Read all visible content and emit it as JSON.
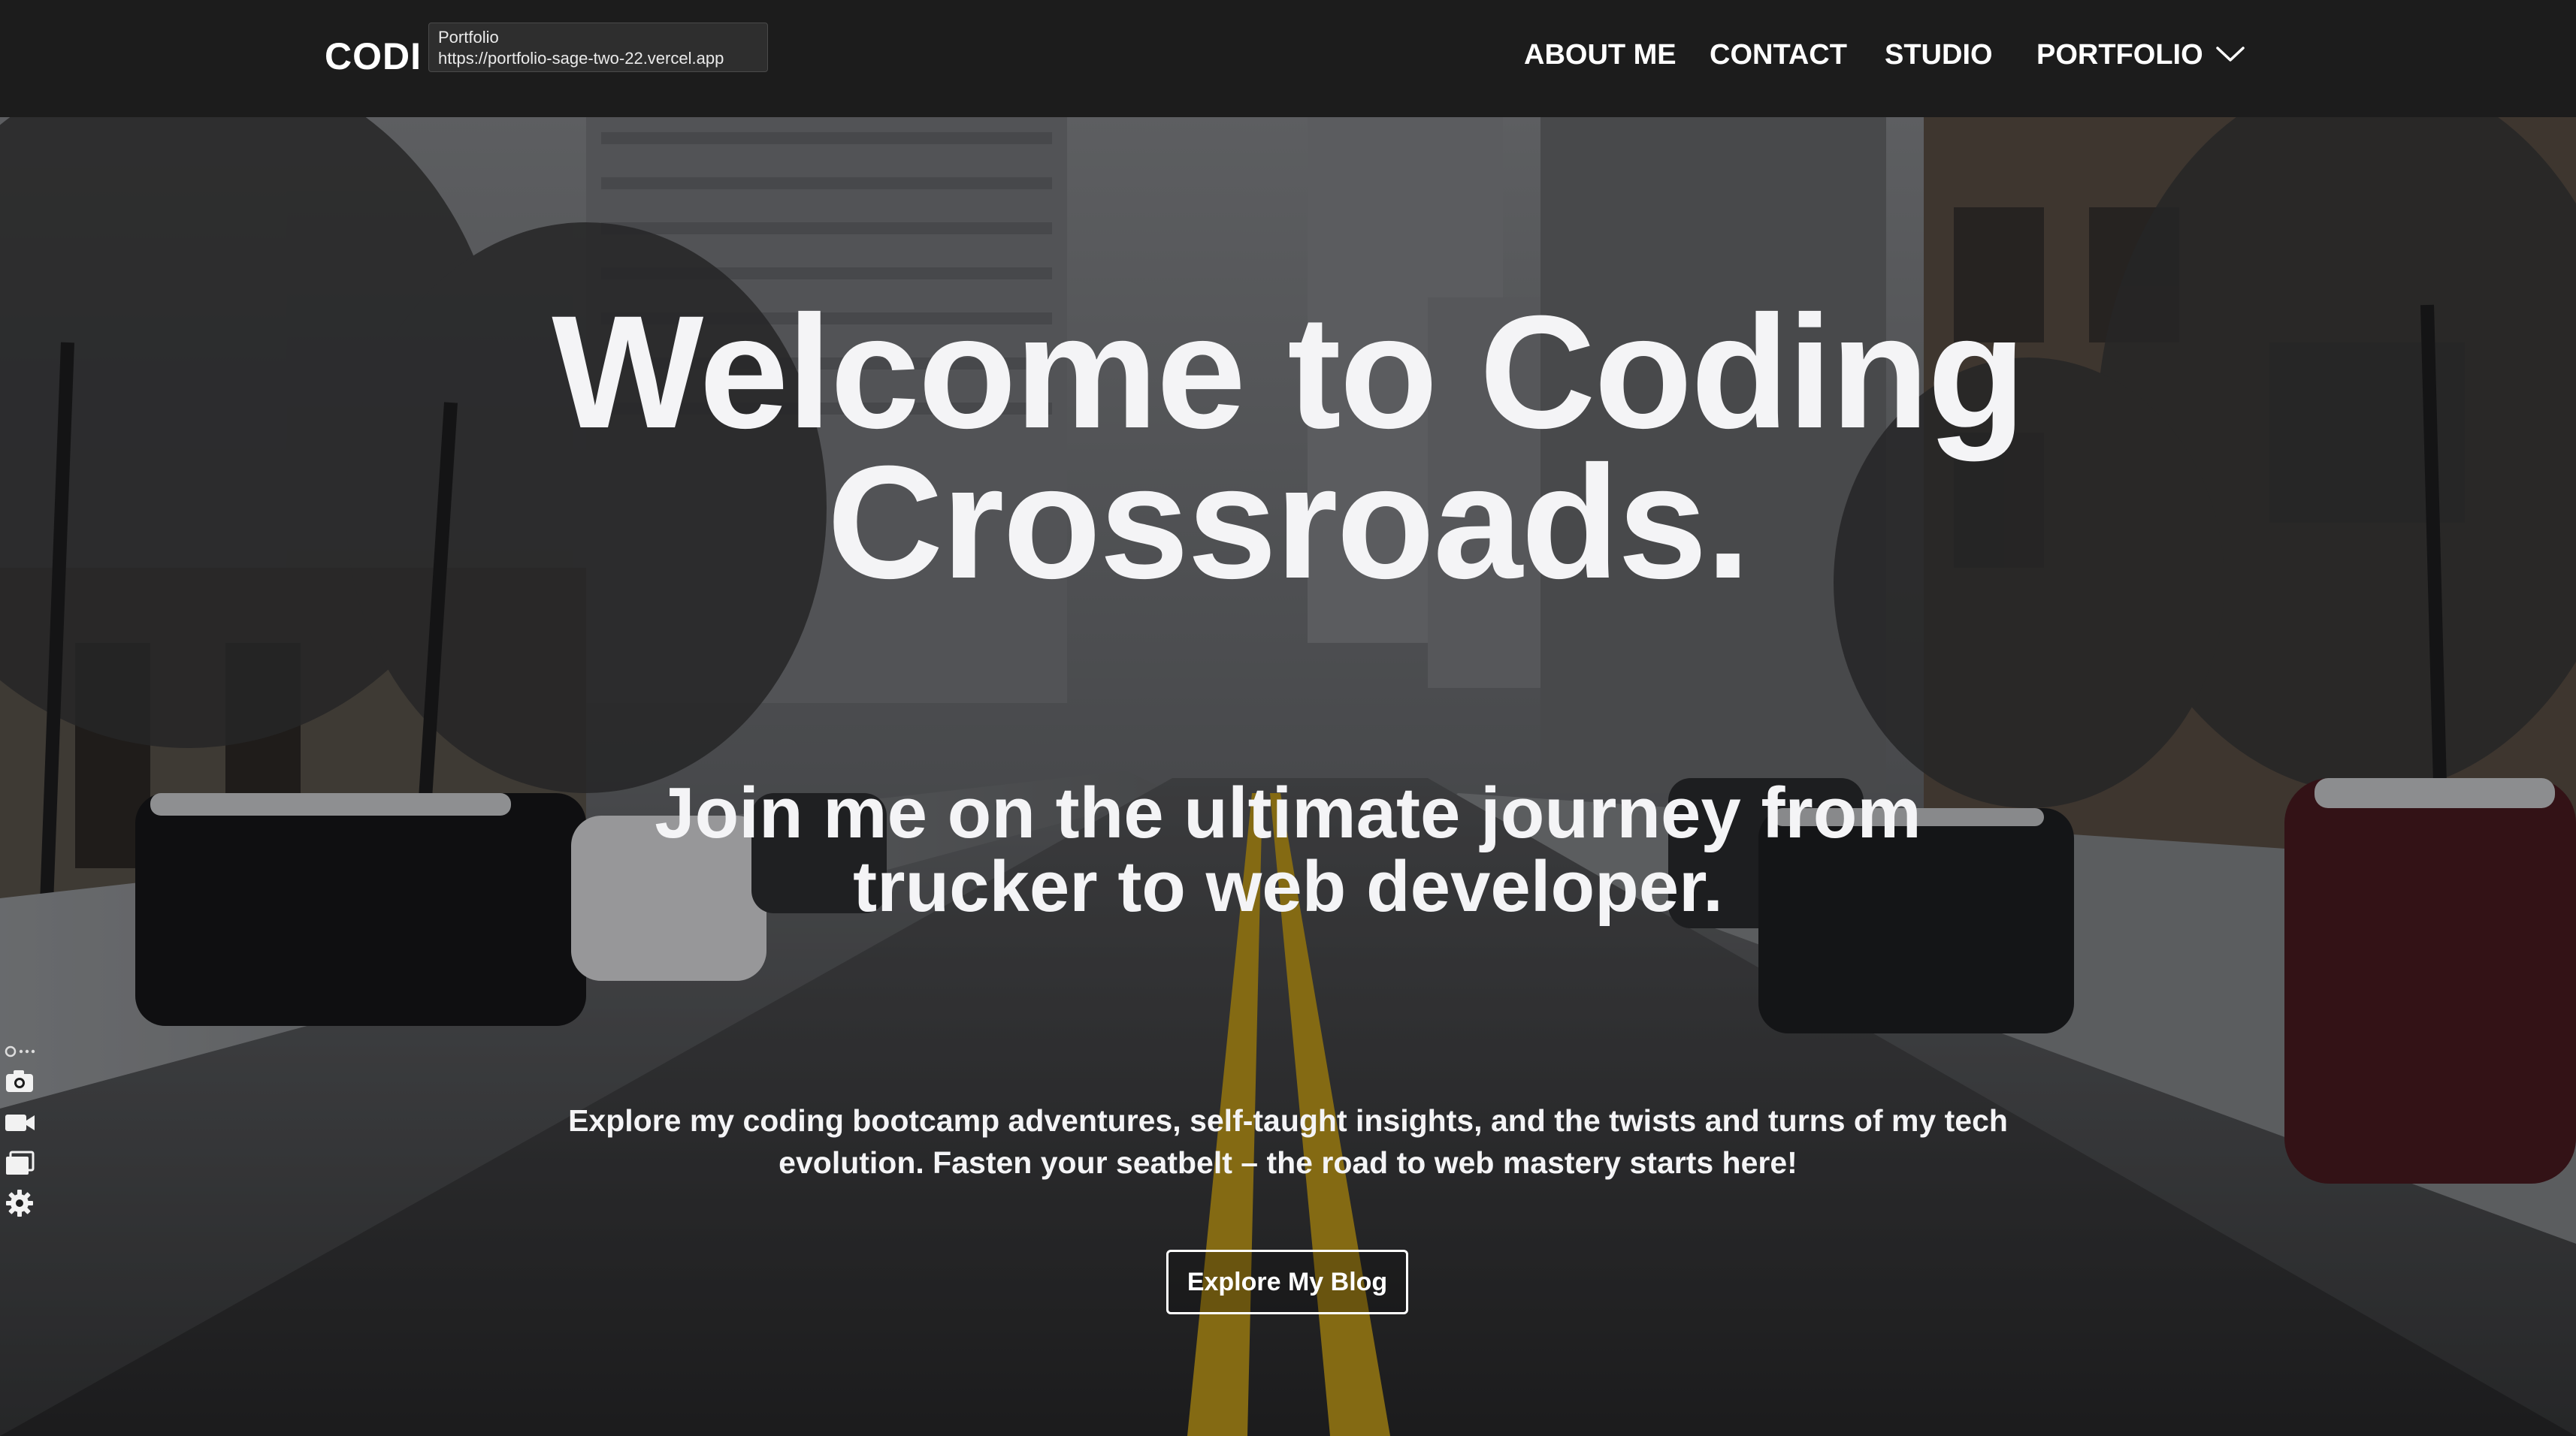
{
  "navbar": {
    "brand": "CODI",
    "tooltip": {
      "title": "Portfolio",
      "url": "https://portfolio-sage-two-22.vercel.app"
    },
    "links": {
      "about": "ABOUT ME",
      "contact": "CONTACT",
      "studio": "STUDIO",
      "portfolio": "PORTFOLIO"
    }
  },
  "hero": {
    "headline_line1": "Welcome to Coding",
    "headline_line2": "Crossroads.",
    "subheadline_line1": "Join me on the ultimate journey from",
    "subheadline_line2": "trucker to web developer.",
    "description_line1": "Explore my coding bootcamp adventures, self-taught insights, and the twists and turns of my tech",
    "description_line2": "evolution. Fasten your seatbelt – the road to web mastery starts here!",
    "cta_label": "Explore My Blog"
  },
  "side_tools": {
    "icons": [
      "link-icon",
      "camera-icon",
      "video-icon",
      "windows-icon",
      "gear-icon"
    ]
  },
  "colors": {
    "navbar_bg": "#1c1c1c",
    "text": "#f4f4f6",
    "road_line": "#c9a21e"
  }
}
